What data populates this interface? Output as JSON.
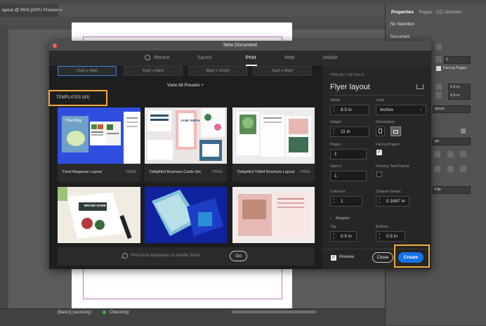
{
  "app": {
    "doc_tab": "ayout @ 65% [GPU Preview]",
    "status_mode": "[Basic] (working)",
    "status_check": "Checking"
  },
  "right_panel": {
    "tabs": [
      "Properties",
      "Pages",
      "CC Libraries"
    ],
    "no_selection": "No Selection",
    "document_label": "Document",
    "facing_pages": "Facing Pages",
    "field_values": [
      "1",
      "0.5 in",
      "0.5 in",
      "ayout",
      "ge",
      "File"
    ]
  },
  "dialog": {
    "title": "New Document",
    "tabs": {
      "recent": "Recent",
      "saved": "Saved",
      "print": "Print",
      "web": "Web",
      "mobile": "Mobile"
    },
    "presets": [
      "51p0 x 66p0",
      "51p0 x 66p0",
      "66p0 x 102p0",
      "51p0 x 66p0"
    ],
    "view_all": "View All Presets  +",
    "templates_label": "TEMPLATES  (63)",
    "templates": [
      {
        "name": "Food Magazine Layout",
        "badge": "FREE"
      },
      {
        "name": "Delightful Business Cards Set",
        "badge": "FREE"
      },
      {
        "name": "Delightful Trifold Brochure Layout",
        "badge": "FREE"
      }
    ],
    "card_texts": {
      "yourway": "YourWay",
      "jane": "JANE SMITH",
      "brand": "BRAND NAME"
    },
    "search_placeholder": "Find more templates on Adobe Stock",
    "go": "Go",
    "details": {
      "header": "PRESET DETAILS",
      "name": "Flyer layout",
      "width_label": "Width",
      "width": "8.5 in",
      "units_label": "Units",
      "units": "Inches",
      "height_label": "Height",
      "height": "11 in",
      "orientation_label": "Orientation",
      "pages_label": "Pages",
      "pages": "1",
      "facing_label": "Facing Pages",
      "start_label": "Start #",
      "start": "1",
      "primary_label": "Primary Text Frame",
      "columns_label": "Columns",
      "columns": "1",
      "gutter_label": "Column Gutter",
      "gutter": "0.1667 in",
      "margins_label": "Margins",
      "top_label": "Top",
      "top": "0.5 in",
      "bottom_label": "Bottom",
      "bottom": "0.5 in",
      "preview_label": "Preview",
      "close": "Close",
      "create": "Create"
    }
  },
  "colors": {
    "accent_blue": "#1473e6",
    "highlight_orange": "#f2a93b"
  }
}
